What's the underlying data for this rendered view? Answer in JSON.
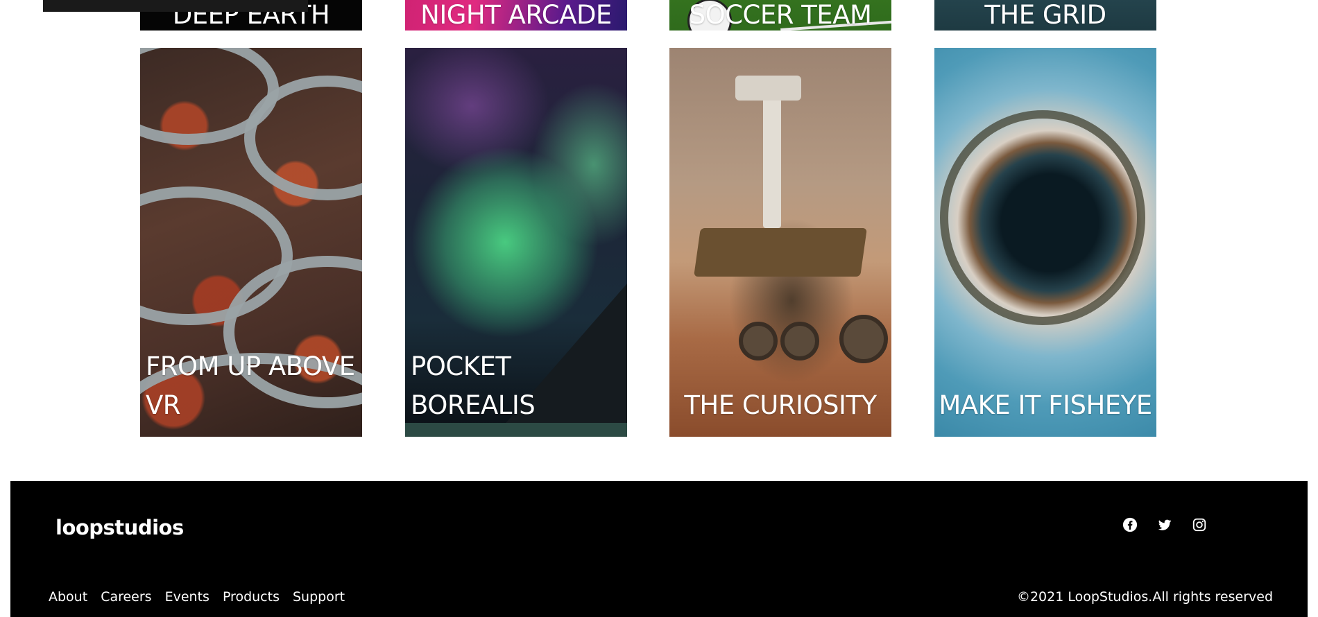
{
  "top_row": [
    {
      "label": "DEEP EARTH"
    },
    {
      "label": "NIGHT ARCADE"
    },
    {
      "label": "SOCCER TEAM"
    },
    {
      "label": "THE GRID"
    }
  ],
  "creations": [
    {
      "label_line1": "FROM UP ABOVE",
      "label_line2": "VR"
    },
    {
      "label_line1": "POCKET",
      "label_line2": "BOREALIS"
    },
    {
      "label_line1": "",
      "label_line2": "THE CURIOSITY"
    },
    {
      "label_line1": "",
      "label_line2": "MAKE IT FISHEYE"
    }
  ],
  "footer": {
    "logo": "loopstudios",
    "social": [
      "facebook-icon",
      "twitter-icon",
      "instagram-icon"
    ],
    "nav": [
      "About",
      "Careers",
      "Events",
      "Products",
      "Support"
    ],
    "copyright": "©2021 LoopStudios.All rights reserved"
  },
  "colors": {
    "footer_bg": "#000000",
    "page_bg": "#ffffff",
    "text_on_dark": "#ffffff"
  }
}
